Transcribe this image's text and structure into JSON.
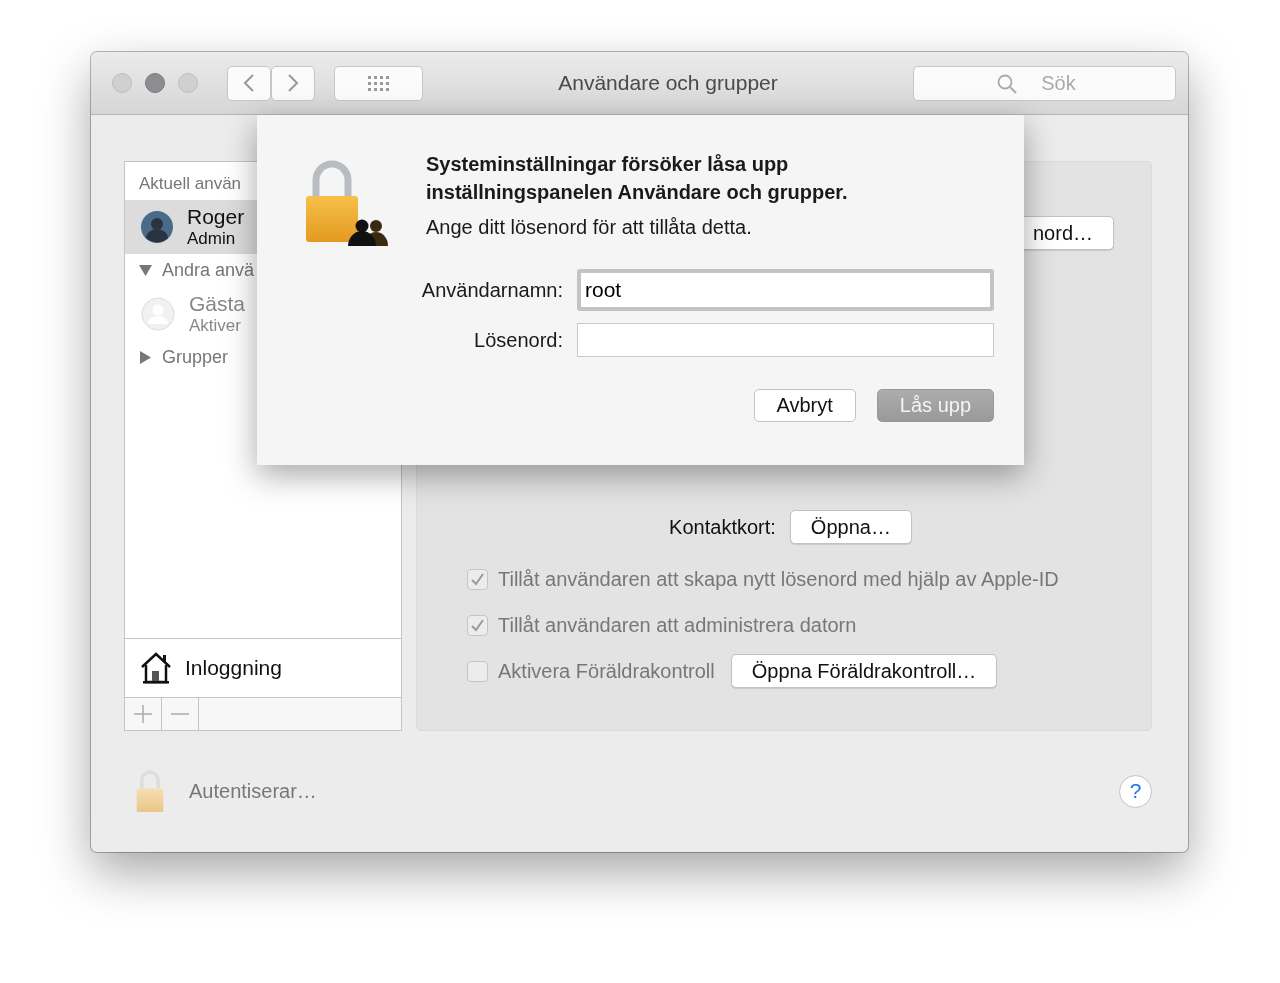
{
  "window": {
    "title": "Användare och grupper",
    "search": {
      "placeholder": "Sök"
    }
  },
  "sidebar": {
    "header": "Aktuell använ",
    "users": [
      {
        "name": "Roger",
        "role": "Admin",
        "selected": true
      }
    ],
    "groups": [
      {
        "label": "Andra anvä",
        "expanded": true,
        "children": [
          {
            "name": "Gästa",
            "detail": "Aktiver",
            "selected": false
          }
        ]
      },
      {
        "label": "Grupper",
        "expanded": false
      }
    ],
    "login_item": "Inloggning"
  },
  "panel": {
    "password_button": "nord…",
    "contact_label": "Kontaktkort:",
    "contact_button": "Öppna…",
    "options": [
      {
        "label": "Tillåt användaren att skapa nytt lösenord med hjälp av Apple-ID",
        "checked": true,
        "disabled": true
      },
      {
        "label": "Tillåt användaren att administrera datorn",
        "checked": true,
        "disabled": true
      },
      {
        "label": "Aktivera Föräldrakontroll",
        "checked": false,
        "disabled": true,
        "button": "Öppna Föräldrakontroll…"
      }
    ]
  },
  "footer": {
    "status": "Autentiserar…",
    "help": "?"
  },
  "dialog": {
    "title": "Systeminställningar försöker låsa upp inställningspanelen Användare och grupper.",
    "message": "Ange ditt lösenord för att tillåta detta.",
    "fields": [
      {
        "label": "Användarnamn:",
        "value": "root",
        "focused": true,
        "kind": "text"
      },
      {
        "label": "Lösenord:",
        "focused": false,
        "kind": "password"
      }
    ],
    "buttons": [
      {
        "label": "Avbryt",
        "disabled": false
      },
      {
        "label": "Lås upp",
        "disabled": true
      }
    ]
  }
}
